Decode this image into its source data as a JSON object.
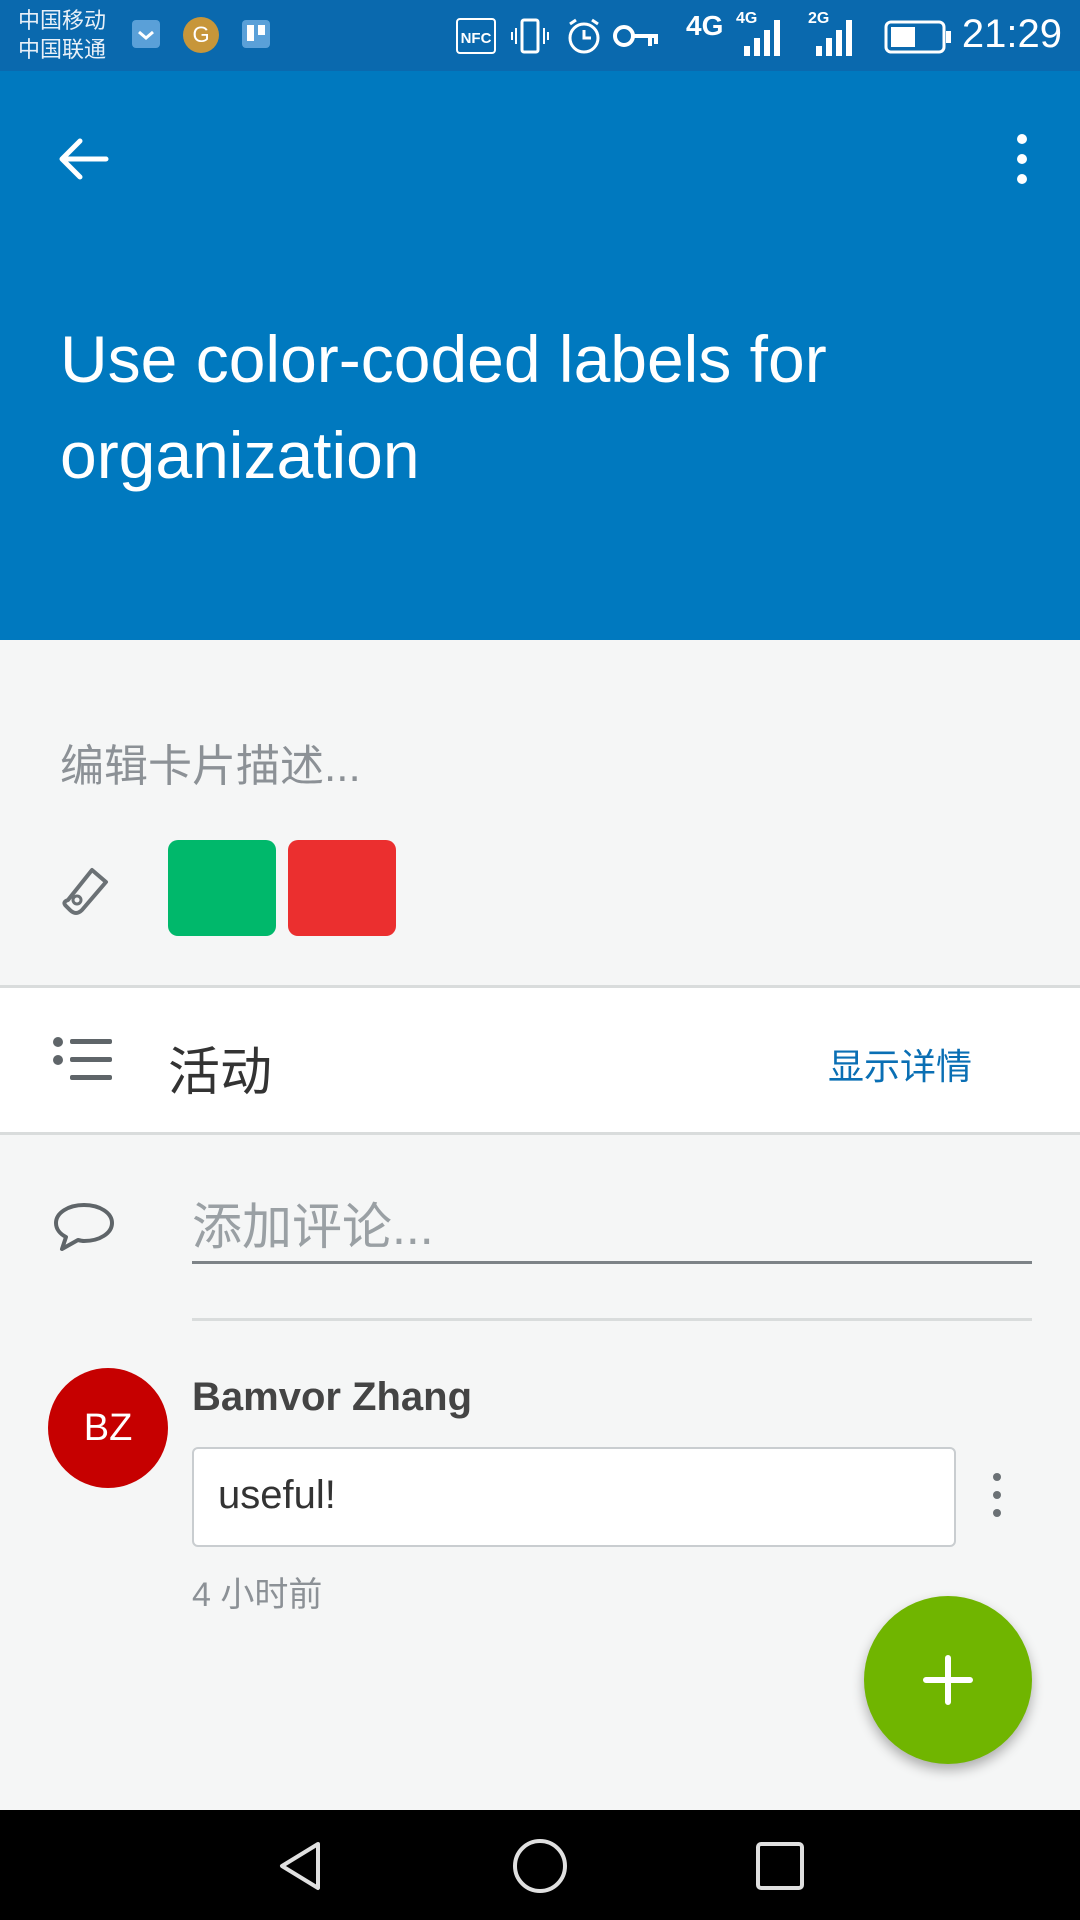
{
  "status_bar": {
    "carrier_1": "中国移动",
    "carrier_2": "中国联通",
    "network_1": "4G",
    "network_2": "4G",
    "network_3": "2G",
    "time": "21:29"
  },
  "header": {
    "title": "Use color-coded labels for organization",
    "background_color": "#0079bf"
  },
  "card": {
    "description_placeholder": "编辑卡片描述...",
    "labels": [
      {
        "color": "#00b86b"
      },
      {
        "color": "#eb2f2f"
      }
    ]
  },
  "activity": {
    "title": "活动",
    "show_details": "显示详情"
  },
  "comment_box": {
    "placeholder": "添加评论..."
  },
  "comments": [
    {
      "avatar_initials": "BZ",
      "author": "Bamvor Zhang",
      "text": "useful!",
      "time": "4 小时前"
    }
  ],
  "fab": {
    "icon": "plus-icon",
    "color": "#70b500"
  },
  "icons": {
    "back": "arrow-left-icon",
    "overflow": "more-vertical-icon",
    "label": "tag-icon",
    "activity": "list-icon",
    "comment": "speech-bubble-icon"
  }
}
